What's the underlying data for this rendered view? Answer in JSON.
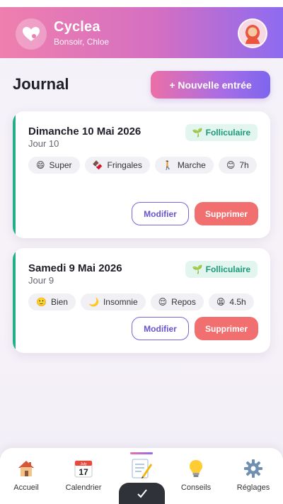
{
  "app": {
    "title": "Cyclea",
    "greeting": "Bonsoir, Chloe"
  },
  "page": {
    "title": "Journal",
    "new_entry_label": "+ Nouvelle entrée"
  },
  "entries": [
    {
      "date": "Dimanche 10 Mai 2026",
      "day": "Jour 10",
      "phase": "Folliculaire",
      "phase_icon": "🌱",
      "tags": [
        {
          "icon": "😄",
          "label": "Super"
        },
        {
          "icon": "🍫",
          "label": "Fringales"
        },
        {
          "icon": "🚶",
          "label": "Marche"
        },
        {
          "icon": "😊",
          "label": "7h"
        }
      ],
      "edit_label": "Modifier",
      "delete_label": "Supprimer"
    },
    {
      "date": "Samedi 9 Mai 2026",
      "day": "Jour 9",
      "phase": "Folliculaire",
      "phase_icon": "🌱",
      "tags": [
        {
          "icon": "🙂",
          "label": "Bien"
        },
        {
          "icon": "🌙",
          "label": "Insomnie"
        },
        {
          "icon": "😌",
          "label": "Repos"
        },
        {
          "icon": "😫",
          "label": "4.5h"
        }
      ],
      "edit_label": "Modifier",
      "delete_label": "Supprimer"
    }
  ],
  "nav": [
    {
      "label": "Accueil",
      "icon": "home-icon"
    },
    {
      "label": "Calendrier",
      "icon": "calendar-icon",
      "calendar_month": "July",
      "calendar_day": "17"
    },
    {
      "label": "",
      "icon": "journal-icon",
      "active": true
    },
    {
      "label": "Conseils",
      "icon": "lightbulb-icon"
    },
    {
      "label": "Réglages",
      "icon": "gear-icon"
    }
  ],
  "toast": {
    "icon": "check-icon"
  },
  "colors": {
    "accent_pink": "#ec6fa7",
    "accent_purple": "#8d6bf0",
    "phase_green": "#1fb08a",
    "delete_red": "#f26f6f"
  }
}
